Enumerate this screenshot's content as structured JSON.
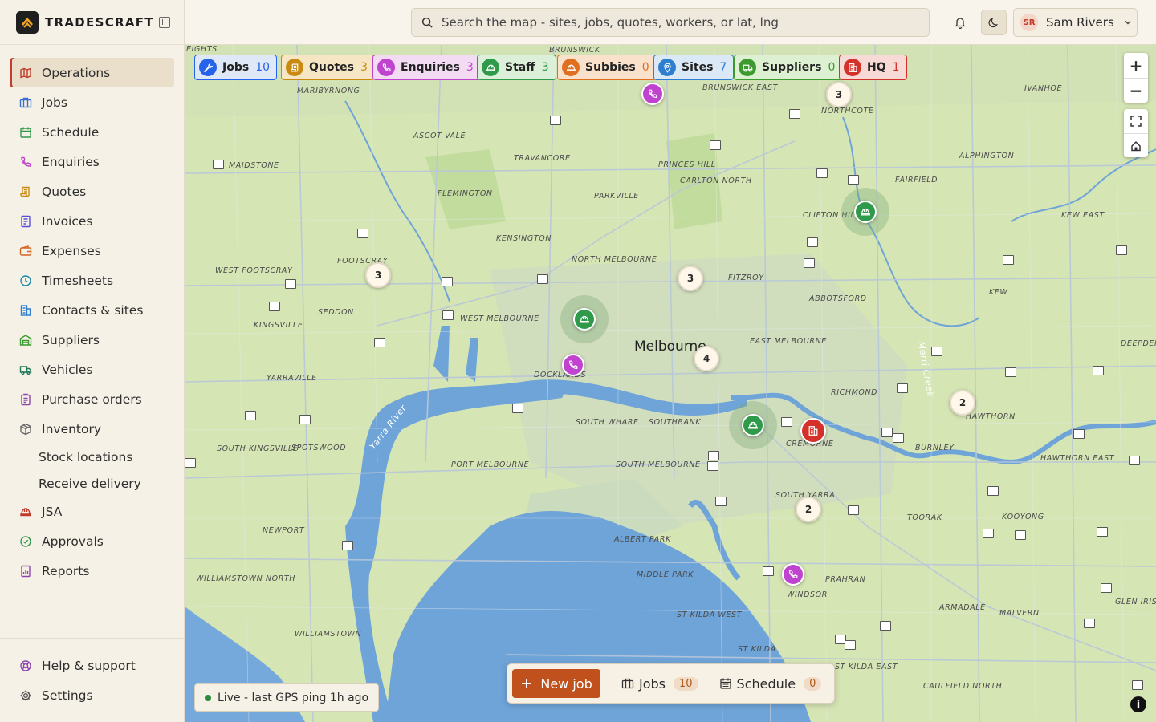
{
  "brand": {
    "name": "TRADESCRAFT"
  },
  "nav": {
    "items": [
      {
        "label": "Operations",
        "icon": "map-icon"
      },
      {
        "label": "Jobs",
        "icon": "briefcase-icon"
      },
      {
        "label": "Schedule",
        "icon": "calendar-icon"
      },
      {
        "label": "Enquiries",
        "icon": "phone-icon"
      },
      {
        "label": "Quotes",
        "icon": "scroll-icon"
      },
      {
        "label": "Invoices",
        "icon": "invoice-icon"
      },
      {
        "label": "Expenses",
        "icon": "wallet-icon"
      },
      {
        "label": "Timesheets",
        "icon": "clock-icon"
      },
      {
        "label": "Contacts & sites",
        "icon": "building-icon"
      },
      {
        "label": "Suppliers",
        "icon": "warehouse-icon"
      },
      {
        "label": "Vehicles",
        "icon": "truck-icon"
      },
      {
        "label": "Purchase orders",
        "icon": "clipboard-icon"
      },
      {
        "label": "Inventory",
        "icon": "package-icon"
      }
    ],
    "inventory_sub": [
      "Stock locations",
      "Receive delivery"
    ],
    "items2": [
      {
        "label": "JSA",
        "icon": "hardhat-icon"
      },
      {
        "label": "Approvals",
        "icon": "check-circle-icon"
      },
      {
        "label": "Reports",
        "icon": "report-icon"
      }
    ],
    "bottom": [
      {
        "label": "Help & support",
        "icon": "lifebuoy-icon"
      },
      {
        "label": "Settings",
        "icon": "gear-icon"
      }
    ]
  },
  "search": {
    "placeholder": "Search the map - sites, jobs, quotes, workers, or lat, lng"
  },
  "user": {
    "initials": "SR",
    "name": "Sam Rivers"
  },
  "filters": [
    {
      "label": "Jobs",
      "count": "10",
      "icon": "wrench-icon",
      "bg": "#dfe8f7",
      "fg": "#2563eb"
    },
    {
      "label": "Quotes",
      "count": "3",
      "icon": "scroll-icon",
      "bg": "#f6e6c4",
      "fg": "#c98a12"
    },
    {
      "label": "Enquiries",
      "count": "3",
      "icon": "phone-icon",
      "bg": "#f2dbf3",
      "fg": "#c043cf"
    },
    {
      "label": "Staff",
      "count": "3",
      "icon": "hardhat-icon",
      "bg": "#dcefd9",
      "fg": "#2e9a4a"
    },
    {
      "label": "Subbies",
      "count": "0",
      "icon": "hardhat-icon",
      "bg": "#f9e1cc",
      "fg": "#e07020"
    },
    {
      "label": "Sites",
      "count": "7",
      "icon": "pin-icon",
      "bg": "#dbe8f5",
      "fg": "#2f7fd1"
    },
    {
      "label": "Suppliers",
      "count": "0",
      "icon": "truck-icon",
      "bg": "#ddf0d2",
      "fg": "#3c9a2e"
    },
    {
      "label": "HQ",
      "count": "1",
      "icon": "building-icon",
      "bg": "#f7d9d6",
      "fg": "#d3312a"
    }
  ],
  "map": {
    "city": "Melbourne",
    "suburbs": [
      "MARIBYRNONG",
      "ASCOT VALE",
      "TRAVANCORE",
      "BRUNSWICK",
      "BRUNSWICK EAST",
      "NORTHCOTE",
      "IVANHOE",
      "ALPHINGTON",
      "FAIRFIELD",
      "KEW EAST",
      "MAIDSTONE",
      "FLEMINGTON",
      "PARKVILLE",
      "PRINCES HILL",
      "CARLTON NORTH",
      "CLIFTON HILL",
      "KENSINGTON",
      "NORTH MELBOURNE",
      "FOOTSCRAY",
      "WEST FOOTSCRAY",
      "FITZROY",
      "ABBOTSFORD",
      "KEW",
      "SEDDON",
      "KINGSVILLE",
      "WEST MELBOURNE",
      "EAST MELBOURNE",
      "YARRAVILLE",
      "DOCKLANDS",
      "RICHMOND",
      "HAWTHORN",
      "SOUTH WHARF",
      "SOUTHBANK",
      "CREMORNE",
      "BURNLEY",
      "HAWTHORN EAST",
      "SOUTH KINGSVILLE",
      "SPOTSWOOD",
      "PORT MELBOURNE",
      "SOUTH MELBOURNE",
      "SOUTH YARRA",
      "TOORAK",
      "KOOYONG",
      "NEWPORT",
      "ALBERT PARK",
      "MIDDLE PARK",
      "PRAHRAN",
      "WINDSOR",
      "WILLIAMSTOWN NORTH",
      "WILLIAMSTOWN",
      "ST KILDA WEST",
      "ST KILDA",
      "ST KILDA EAST",
      "ARMADALE",
      "MALVERN",
      "CAULFIELD NORTH",
      "GLEN IRIS",
      "DEEPDENE",
      "EIGHTS"
    ],
    "rivers": [
      "Yarra River",
      "Merri Creek"
    ],
    "clusters": [
      "3",
      "3",
      "3",
      "4",
      "2",
      "2"
    ]
  },
  "live": {
    "text": "Live - last GPS ping 1h ago"
  },
  "actions": {
    "new_job": "New job",
    "jobs": "Jobs",
    "jobs_count": "10",
    "schedule": "Schedule",
    "schedule_count": "0"
  }
}
